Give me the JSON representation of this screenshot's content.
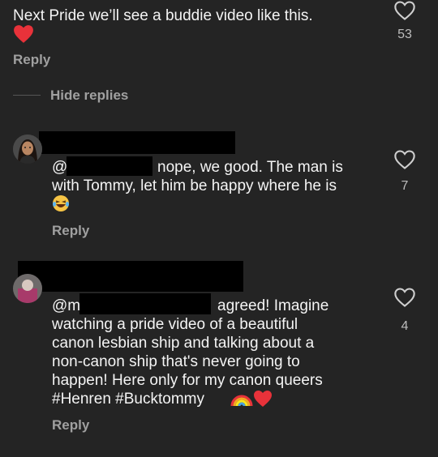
{
  "top_comment": {
    "text": "Next Pride we’ll see a buddie video like this.",
    "likes": "53",
    "reply_label": "Reply"
  },
  "hide_replies_label": "Hide replies",
  "reply1": {
    "mention_prefix": "@s",
    "text_line1": "nope, we good. The man is",
    "text_line2": "with Tommy, let him be happy where he is",
    "likes": "7",
    "reply_label": "Reply"
  },
  "reply2": {
    "mention_prefix": "@m",
    "line1": "agreed! Imagine",
    "line2": "watching a pride video of a beautiful",
    "line3": "canon lesbian ship and talking about a",
    "line4": "non-canon ship that's never going to",
    "line5": "happen! Here only for my canon queers",
    "hashtags": "#Henren #Bucktommy",
    "likes": "4",
    "reply_label": "Reply"
  },
  "colors": {
    "background": "#242424",
    "heart": "#e8323a",
    "muted": "#a0a0a0"
  },
  "icons": [
    "heart-outline-icon",
    "red-heart-emoji",
    "laughing-emoji",
    "rainbow-emoji",
    "avatar"
  ]
}
